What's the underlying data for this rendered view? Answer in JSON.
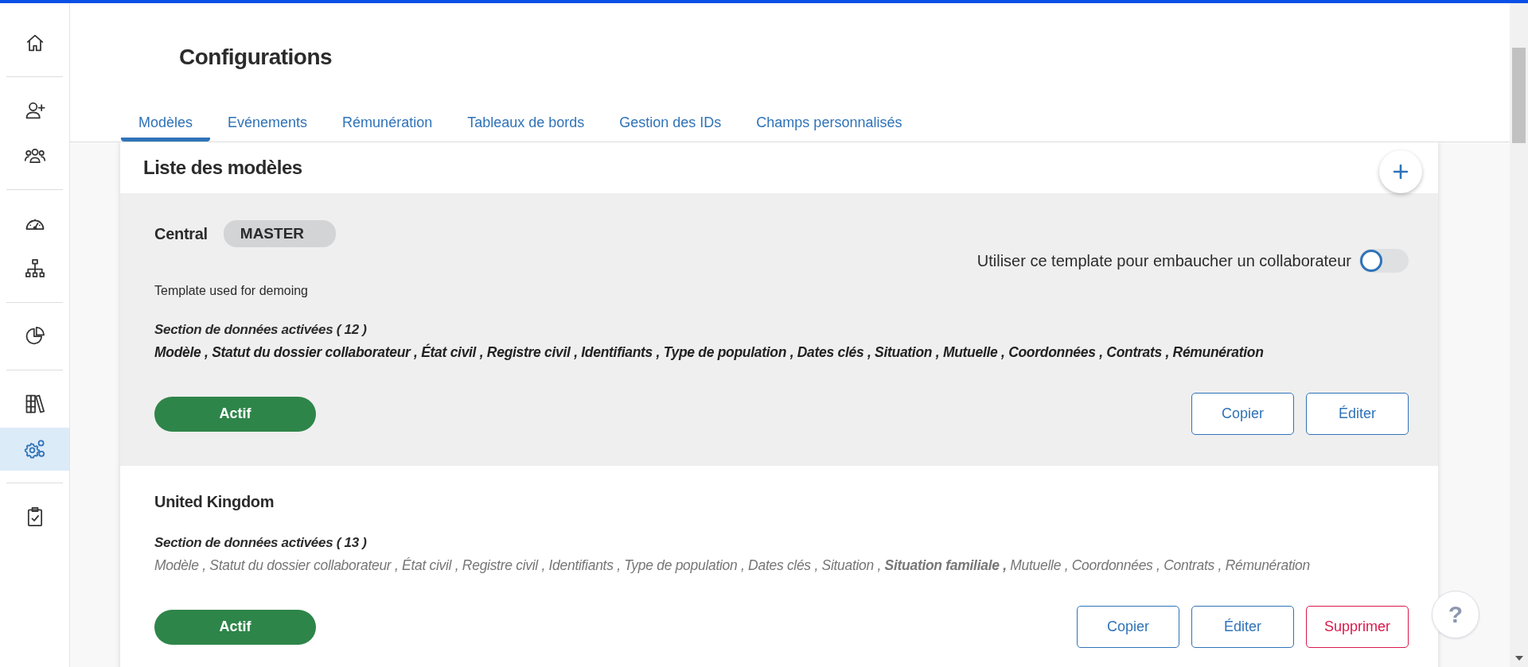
{
  "sidebar": {
    "groups": [
      {
        "items": [
          {
            "selected": false
          }
        ]
      },
      {
        "items": [
          {
            "selected": false
          },
          {
            "selected": false
          }
        ]
      },
      {
        "items": [
          {
            "selected": false
          },
          {
            "selected": false
          }
        ]
      },
      {
        "items": [
          {
            "selected": false
          }
        ]
      },
      {
        "items": [
          {
            "selected": false
          },
          {
            "selected": true
          }
        ]
      },
      {
        "items": [
          {
            "selected": false
          }
        ]
      }
    ]
  },
  "page": {
    "title": "Configurations"
  },
  "tabs": [
    {
      "label": "Modèles",
      "selected": true
    },
    {
      "label": "Evénements",
      "selected": false
    },
    {
      "label": "Rémunération",
      "selected": false
    },
    {
      "label": "Tableaux de bords",
      "selected": false
    },
    {
      "label": "Gestion des IDs",
      "selected": false
    },
    {
      "label": "Champs personnalisés",
      "selected": false
    }
  ],
  "card": {
    "title": "Liste des modèles",
    "models": [
      {
        "name": "Central",
        "badge": "MASTER",
        "highlighted": true,
        "toggle": {
          "label": "Utiliser ce template pour embaucher un collaborateur",
          "on": false
        },
        "description": "Template used for demoing",
        "sections_title": "Section de données activées ( 12 )",
        "emphasized": true,
        "sections": "Modèle , Statut du dossier collaborateur , État civil , Registre civil , Identifiants , Type de population , Dates clés , Situation , Mutuelle , Coordonnées , Contrats , Rémunération",
        "status": "Actif",
        "actions": [
          {
            "label": "Copier",
            "kind": "default"
          },
          {
            "label": "Éditer",
            "kind": "default"
          }
        ]
      },
      {
        "name": "United Kingdom",
        "highlighted": false,
        "sections_title": "Section de données activées ( 13 )",
        "emphasized": false,
        "sections": "Modèle , Statut du dossier collaborateur , État civil , Registre civil , Identifiants , Type de population , Dates clés , Situation , **Situation familiale ,** Mutuelle , Coordonnées , Contrats , Rémunération",
        "status": "Actif",
        "actions": [
          {
            "label": "Copier",
            "kind": "default"
          },
          {
            "label": "Éditer",
            "kind": "default"
          },
          {
            "label": "Supprimer",
            "kind": "danger"
          }
        ]
      }
    ]
  },
  "help_button": "?"
}
